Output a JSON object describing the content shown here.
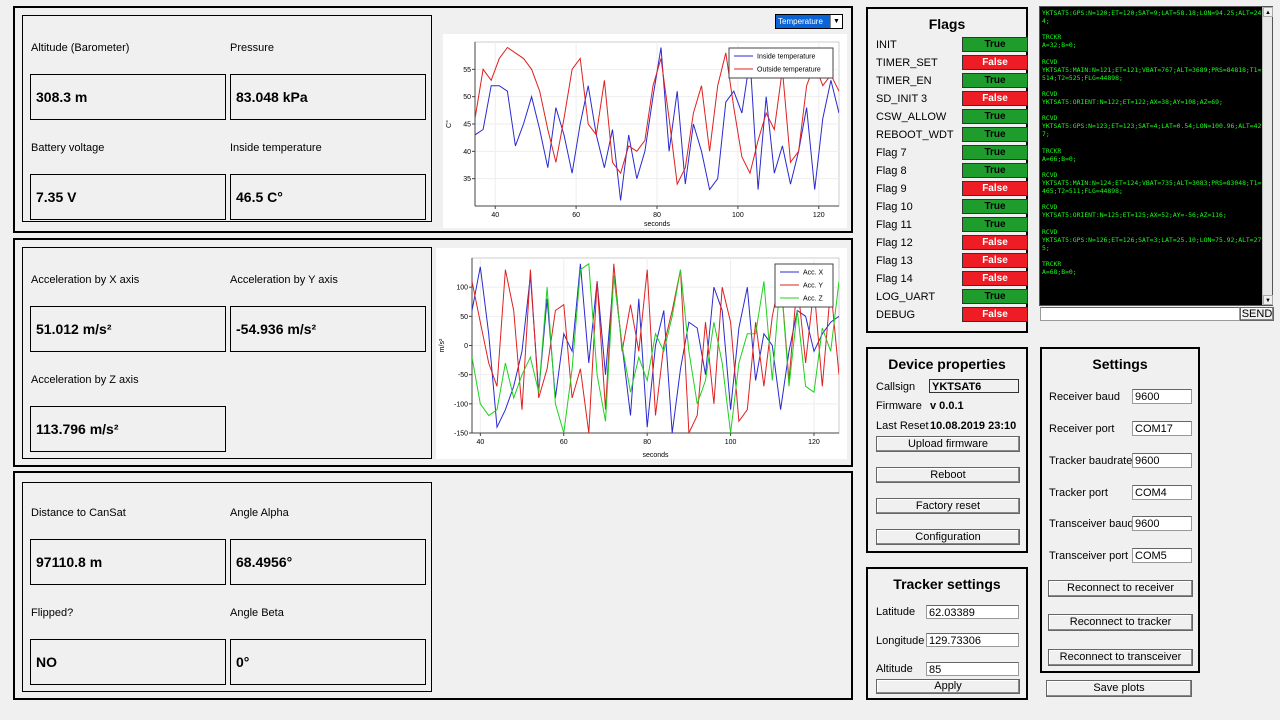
{
  "telemetry": {
    "altitude_label": "Altitude (Barometer)",
    "altitude_value": "308.3 m",
    "pressure_label": "Pressure",
    "pressure_value": "83.048 kPa",
    "battery_label": "Battery voltage",
    "battery_value": "7.35 V",
    "inside_temp_label": "Inside temperature",
    "inside_temp_value": "46.5 C°"
  },
  "acceleration": {
    "x_label": "Acceleration by X axis",
    "x_value": "51.012 m/s²",
    "y_label": "Acceleration by Y axis",
    "y_value": "-54.936 m/s²",
    "z_label": "Acceleration by Z axis",
    "z_value": "113.796 m/s²"
  },
  "position": {
    "distance_label": "Distance to CanSat",
    "distance_value": "97110.8 m",
    "alpha_label": "Angle Alpha",
    "alpha_value": "68.4956°",
    "flipped_label": "Flipped?",
    "flipped_value": "NO",
    "beta_label": "Angle Beta",
    "beta_value": "0°"
  },
  "chart_selector": {
    "selected": "Temperature"
  },
  "chart_data": [
    {
      "type": "line",
      "xlabel": "seconds",
      "ylabel": "C°",
      "xlim": [
        35,
        125
      ],
      "ylim": [
        30,
        60
      ],
      "x_ticks": [
        40,
        60,
        80,
        100,
        120
      ],
      "y_ticks": [
        35,
        40,
        45,
        50,
        55
      ],
      "legend_position": "top-right",
      "colors": [
        "#2a2ad0",
        "#e02020"
      ],
      "series": [
        {
          "name": "Inside temperature",
          "x": [
            35,
            37,
            39,
            41,
            43,
            45,
            47,
            49,
            51,
            53,
            55,
            57,
            59,
            61,
            63,
            65,
            67,
            69,
            71,
            73,
            75,
            77,
            79,
            81,
            83,
            85,
            87,
            89,
            91,
            93,
            95,
            97,
            99,
            101,
            103,
            105,
            107,
            109,
            111,
            113,
            115,
            117,
            119,
            121,
            123,
            125
          ],
          "y": [
            43,
            44,
            52,
            52,
            51,
            41,
            45,
            50,
            44,
            37,
            48,
            43,
            36,
            45,
            52,
            43,
            37,
            44,
            31,
            43,
            35,
            40,
            50,
            59,
            40,
            51,
            34,
            45,
            40,
            33,
            35,
            49,
            51,
            47,
            57,
            33,
            50,
            36,
            41,
            34,
            40,
            48,
            33,
            46,
            53,
            47
          ]
        },
        {
          "name": "Outside temperature",
          "x": [
            35,
            37,
            39,
            41,
            43,
            45,
            47,
            49,
            51,
            53,
            55,
            57,
            59,
            61,
            63,
            65,
            67,
            69,
            71,
            73,
            75,
            77,
            79,
            81,
            83,
            85,
            87,
            89,
            91,
            93,
            95,
            97,
            99,
            101,
            103,
            105,
            107,
            109,
            111,
            113,
            115,
            117,
            119,
            121,
            123,
            125
          ],
          "y": [
            46,
            55,
            53,
            57,
            59,
            58,
            57,
            55,
            51,
            44,
            38,
            46,
            55,
            57,
            45,
            43,
            53,
            38,
            36,
            41,
            40,
            42,
            52,
            57,
            46,
            34,
            37,
            47,
            52,
            40,
            52,
            58,
            48,
            39,
            36,
            42,
            47,
            44,
            55,
            38,
            40,
            52,
            56,
            52,
            54,
            51
          ]
        }
      ]
    },
    {
      "type": "line",
      "xlabel": "seconds",
      "ylabel": "m/s²",
      "xlim": [
        38,
        126
      ],
      "ylim": [
        -150,
        150
      ],
      "x_ticks": [
        40,
        60,
        80,
        100,
        120
      ],
      "y_ticks": [
        -150,
        -100,
        -50,
        0,
        50,
        100
      ],
      "legend_position": "top-right",
      "colors": [
        "#2a2ad0",
        "#e02020",
        "#20d020"
      ],
      "series": [
        {
          "name": "Acc. X",
          "x": [
            38,
            40,
            42,
            44,
            46,
            48,
            50,
            52,
            54,
            56,
            58,
            60,
            62,
            64,
            66,
            68,
            70,
            72,
            74,
            76,
            78,
            80,
            82,
            84,
            86,
            88,
            90,
            92,
            94,
            96,
            98,
            100,
            102,
            104,
            106,
            108,
            110,
            112,
            114,
            116,
            118,
            120,
            122,
            124,
            126
          ],
          "y": [
            60,
            135,
            20,
            -140,
            -110,
            -70,
            -10,
            120,
            -80,
            80,
            -90,
            20,
            -10,
            140,
            -30,
            110,
            -50,
            120,
            0,
            -120,
            80,
            -140,
            0,
            60,
            -150,
            -40,
            40,
            30,
            -50,
            100,
            60,
            -110,
            30,
            100,
            -60,
            20,
            0,
            -110,
            -10,
            60,
            50,
            -10,
            20,
            40,
            50
          ]
        },
        {
          "name": "Acc. Y",
          "x": [
            38,
            40,
            42,
            44,
            46,
            48,
            50,
            52,
            54,
            56,
            58,
            60,
            62,
            64,
            66,
            68,
            70,
            72,
            74,
            76,
            78,
            80,
            82,
            84,
            86,
            88,
            90,
            92,
            94,
            96,
            98,
            100,
            102,
            104,
            106,
            108,
            110,
            112,
            114,
            116,
            118,
            120,
            122,
            124,
            126
          ],
          "y": [
            110,
            40,
            -30,
            -70,
            130,
            60,
            -110,
            130,
            -90,
            -40,
            60,
            70,
            -90,
            -40,
            -150,
            110,
            -110,
            140,
            -10,
            70,
            -10,
            130,
            -120,
            0,
            60,
            130,
            -150,
            -120,
            40,
            -100,
            100,
            40,
            -130,
            -110,
            40,
            -70,
            50,
            120,
            -60,
            110,
            -30,
            100,
            -70,
            100,
            -50
          ]
        },
        {
          "name": "Acc. Z",
          "x": [
            38,
            40,
            42,
            44,
            46,
            48,
            50,
            52,
            54,
            56,
            58,
            60,
            62,
            64,
            66,
            68,
            70,
            72,
            74,
            76,
            78,
            80,
            82,
            84,
            86,
            88,
            90,
            92,
            94,
            96,
            98,
            100,
            102,
            104,
            106,
            108,
            110,
            112,
            114,
            116,
            118,
            120,
            122,
            124,
            126
          ],
          "y": [
            -20,
            -100,
            -120,
            -110,
            -30,
            -90,
            -50,
            -20,
            -80,
            100,
            -100,
            -150,
            -40,
            130,
            140,
            -50,
            -130,
            120,
            0,
            -80,
            -20,
            -60,
            20,
            -10,
            50,
            130,
            -10,
            -100,
            -60,
            40,
            -30,
            -150,
            -30,
            20,
            20,
            110,
            -60,
            120,
            -70,
            60,
            -70,
            -80,
            30,
            -10,
            110
          ]
        }
      ]
    }
  ],
  "flags": {
    "title": "Flags",
    "items": [
      {
        "name": "INIT",
        "value": "True",
        "state": "true"
      },
      {
        "name": "TIMER_SET",
        "value": "False",
        "state": "false"
      },
      {
        "name": "TIMER_EN",
        "value": "True",
        "state": "true"
      },
      {
        "name": "SD_INIT 3",
        "value": "False",
        "state": "false"
      },
      {
        "name": "CSW_ALLOW",
        "value": "True",
        "state": "true"
      },
      {
        "name": "REBOOT_WDT",
        "value": "True",
        "state": "true"
      },
      {
        "name": "Flag 7",
        "value": "True",
        "state": "true"
      },
      {
        "name": "Flag 8",
        "value": "True",
        "state": "true"
      },
      {
        "name": "Flag 9",
        "value": "False",
        "state": "false"
      },
      {
        "name": "Flag 10",
        "value": "True",
        "state": "true"
      },
      {
        "name": "Flag 11",
        "value": "True",
        "state": "true"
      },
      {
        "name": "Flag 12",
        "value": "False",
        "state": "false"
      },
      {
        "name": "Flag 13",
        "value": "False",
        "state": "false"
      },
      {
        "name": "Flag 14",
        "value": "False",
        "state": "false"
      },
      {
        "name": "LOG_UART",
        "value": "True",
        "state": "true"
      },
      {
        "name": "DEBUG",
        "value": "False",
        "state": "false"
      }
    ],
    "colors": {
      "true": "#1e9d2c",
      "false": "#ee1c24"
    }
  },
  "console": {
    "text": "YKTSAT5:GPS:N=120;ET=120;SAT=9;LAT=58.18;LON=94.25;ALT=244;\n\nTRCKR\nA=32;B=0;\n\nRCVD\nYKTSAT5:MAIN:N=121;ET=121;VBAT=767;ALT=3689;PRS=84818;T1=514;T2=525;FLG=44898;\n\nRCVD\nYKTSAT5:ORIENT:N=122;ET=122;AX=38;AY=108;AZ=69;\n\nRCVD\nYKTSAT5:GPS:N=123;ET=123;SAT=4;LAT=0.54;LON=100.96;ALT=427;\n\nTRCKR\nA=66;B=0;\n\nRCVD\nYKTSAT5:MAIN:N=124;ET=124;VBAT=735;ALT=3083;PRS=83048;T1=465;T2=511;FLG=44898;\n\nRCVD\nYKTSAT5:ORIENT:N=125;ET=125;AX=52;AY=-56;AZ=116;\n\nRCVD\nYKTSAT5:GPS:N=126;ET=126;SAT=3;LAT=25.10;LON=75.92;ALT=275;\n\nTRCKR\nA=68;B=0;",
    "input_value": "",
    "send_label": "SEND"
  },
  "device": {
    "title": "Device properties",
    "callsign_label": "Callsign",
    "callsign_value": "YKTSAT6",
    "firmware_label": "Firmware",
    "firmware_value": "v 0.0.1",
    "last_reset_label": "Last Reset",
    "last_reset_value": "10.08.2019 23:10",
    "upload_label": "Upload firmware",
    "reboot_label": "Reboot",
    "factory_reset_label": "Factory reset",
    "configuration_label": "Configuration"
  },
  "settings": {
    "title": "Settings",
    "receiver_baud_label": "Receiver baud",
    "receiver_baud_value": "9600",
    "receiver_port_label": "Receiver port",
    "receiver_port_value": "COM17",
    "tracker_baud_label": "Tracker baudrate",
    "tracker_baud_value": "9600",
    "tracker_port_label": "Tracker port",
    "tracker_port_value": "COM4",
    "transceiver_baud_label": "Transceiver baud",
    "transceiver_baud_value": "9600",
    "transceiver_port_label": "Transceiver port",
    "transceiver_port_value": "COM5",
    "reconnect_receiver_label": "Reconnect to receiver",
    "reconnect_tracker_label": "Reconnect to tracker",
    "reconnect_transceiver_label": "Reconnect to transceiver"
  },
  "tracker": {
    "title": "Tracker settings",
    "latitude_label": "Latitude",
    "latitude_value": "62.03389",
    "longitude_label": "Longitude",
    "longitude_value": "129.73306",
    "altitude_label": "Altitude",
    "altitude_value": "85",
    "apply_label": "Apply"
  },
  "save_plots_label": "Save plots"
}
